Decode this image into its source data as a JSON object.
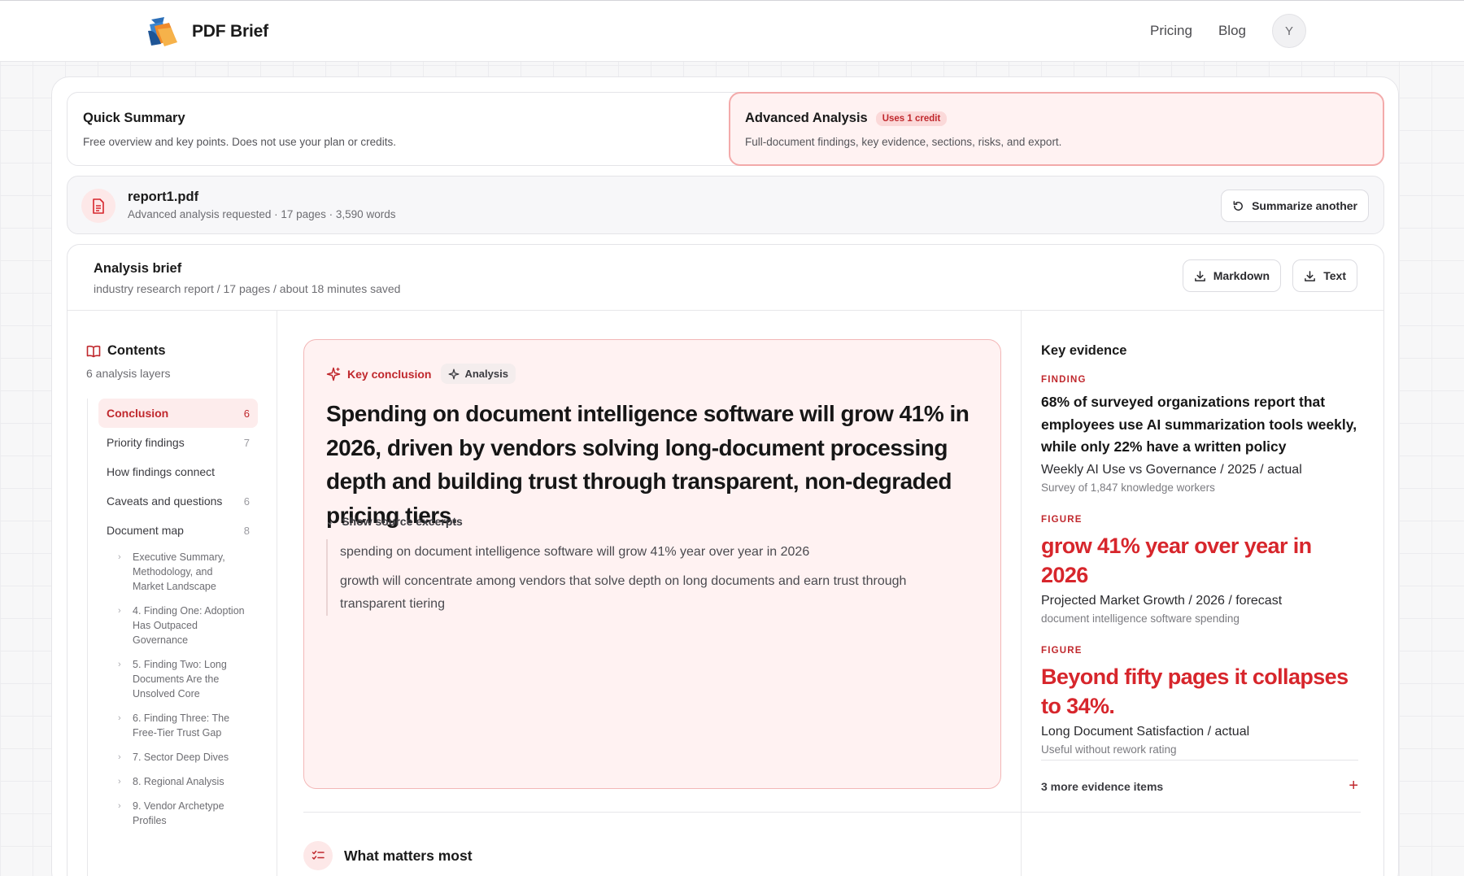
{
  "brand": {
    "name": "PDF Brief",
    "logo_icon": "brand-logo-icon"
  },
  "nav": {
    "pricing": "Pricing",
    "blog": "Blog",
    "avatar_initial": "Y"
  },
  "modes": {
    "quick": {
      "title": "Quick Summary",
      "desc": "Free overview and key points. Does not use your plan or credits."
    },
    "advanced": {
      "title": "Advanced Analysis",
      "badge": "Uses 1 credit",
      "desc": "Full-document findings, key evidence, sections, risks, and export."
    }
  },
  "file": {
    "name": "report1.pdf",
    "meta": "Advanced analysis requested · 17 pages · 3,590 words",
    "action": "Summarize another"
  },
  "analysis": {
    "title": "Analysis brief",
    "subtitle": "industry research report / 17 pages / about 18 minutes saved",
    "export_markdown": "Markdown",
    "export_text": "Text"
  },
  "contents": {
    "title": "Contents",
    "subtitle": "6 analysis layers",
    "items": [
      {
        "label": "Conclusion",
        "count": "6"
      },
      {
        "label": "Priority findings",
        "count": "7"
      },
      {
        "label": "How findings connect",
        "count": ""
      },
      {
        "label": "Caveats and questions",
        "count": "6"
      },
      {
        "label": "Document map",
        "count": "8"
      }
    ],
    "map": [
      "Executive Summary, Methodology, and Market Landscape",
      "4. Finding One: Adoption Has Outpaced Governance",
      "5. Finding Two: Long Documents Are the Unsolved Core",
      "6. Finding Three: The Free-Tier Trust Gap",
      "7. Sector Deep Dives",
      "8. Regional Analysis",
      "9. Vendor Archetype Profiles"
    ]
  },
  "conclusion": {
    "tag_key": "Key conclusion",
    "tag_analysis": "Analysis",
    "text": "Spending on document intelligence software will grow 41% in 2026, driven by vendors solving long-document processing depth and building trust through transparent, non-degraded pricing tiers.",
    "toggle": "Show source excerpts",
    "excerpts": [
      "spending on document intelligence software will grow 41% year over year in 2026",
      "growth will concentrate among vendors that solve depth on long documents and earn trust through transparent tiering"
    ]
  },
  "evidence": {
    "title": "Key evidence",
    "items": [
      {
        "kicker": "FINDING",
        "claim": "68% of surveyed organizations report that employees use AI summarization tools weekly, while only 22% have a written policy",
        "label": "Weekly AI Use vs Governance / 2025 / actual",
        "note": "Survey of 1,847 knowledge workers"
      },
      {
        "kicker": "FIGURE",
        "claim": "grow 41% year over year in 2026",
        "label": "Projected Market Growth / 2026 / forecast",
        "note": "document intelligence software spending"
      },
      {
        "kicker": "FIGURE",
        "claim": "Beyond fifty pages it collapses to 34%.",
        "label": "Long Document Satisfaction / actual",
        "note": "Useful without rework rating"
      }
    ],
    "more": "3 more evidence items"
  },
  "matters": {
    "title": "What matters most"
  },
  "colors": {
    "accent": "#c0282d",
    "accent_bright": "#d7262c",
    "accent_soft": "#fff2f2",
    "border": "#e4e4e8"
  }
}
